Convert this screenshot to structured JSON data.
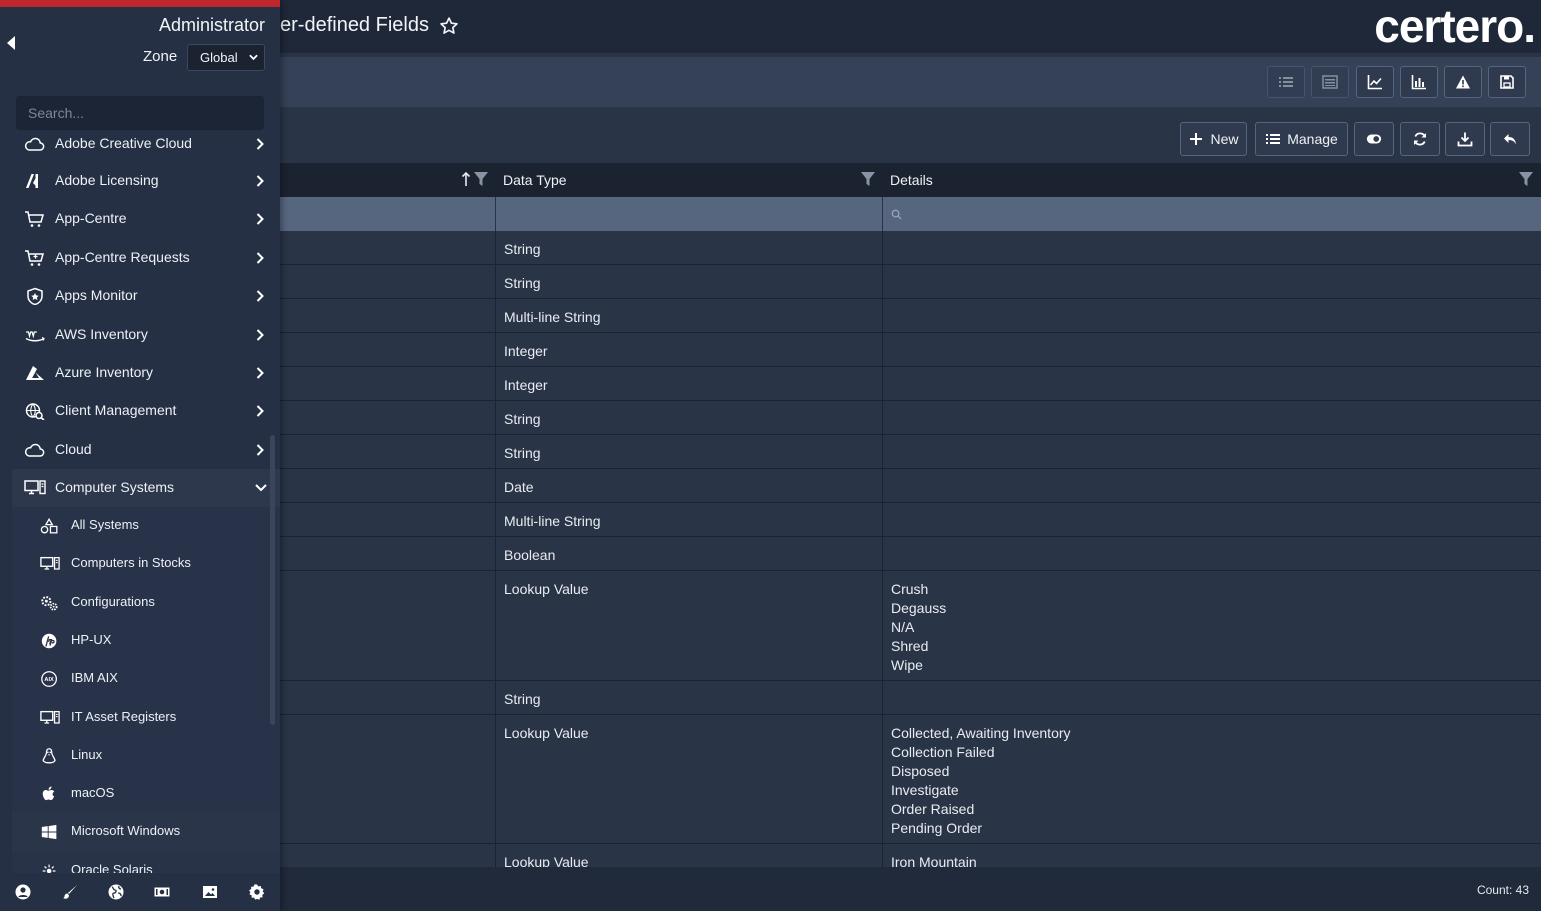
{
  "header": {
    "title": "er-defined Fields",
    "logo": "certero."
  },
  "sidebar": {
    "user": "Administrator",
    "zone_label": "Zone",
    "zone_value": "Global",
    "search_placeholder": "Search...",
    "items": [
      {
        "label": "Adobe Creative Cloud",
        "icon": "cloud-icon"
      },
      {
        "label": "Adobe Licensing",
        "icon": "adobe-icon"
      },
      {
        "label": "App-Centre",
        "icon": "cart-icon"
      },
      {
        "label": "App-Centre Requests",
        "icon": "cart-plus-icon"
      },
      {
        "label": "Apps Monitor",
        "icon": "shield-icon"
      },
      {
        "label": "AWS Inventory",
        "icon": "aws-icon"
      },
      {
        "label": "Azure Inventory",
        "icon": "azure-icon"
      },
      {
        "label": "Client Management",
        "icon": "globe-search-icon"
      },
      {
        "label": "Cloud",
        "icon": "cloud-icon"
      },
      {
        "label": "Computer Systems",
        "icon": "computer-icon"
      }
    ],
    "subitems": [
      {
        "label": "All Systems",
        "icon": "shapes-icon"
      },
      {
        "label": "Computers in Stocks",
        "icon": "computer-icon"
      },
      {
        "label": "Configurations",
        "icon": "gears-icon"
      },
      {
        "label": "HP-UX",
        "icon": "hp-icon"
      },
      {
        "label": "IBM AIX",
        "icon": "aix-icon"
      },
      {
        "label": "IT Asset Registers",
        "icon": "computer-icon"
      },
      {
        "label": "Linux",
        "icon": "linux-icon"
      },
      {
        "label": "macOS",
        "icon": "apple-icon"
      },
      {
        "label": "Microsoft Windows",
        "icon": "windows-icon"
      },
      {
        "label": "Oracle Solaris",
        "icon": "sun-icon"
      }
    ]
  },
  "actions": {
    "new_label": "New",
    "manage_label": "Manage"
  },
  "grid": {
    "columns": [
      "",
      "Data Type",
      "Details"
    ],
    "rows": [
      {
        "type": "String",
        "details": []
      },
      {
        "type": "String",
        "details": []
      },
      {
        "type": "Multi-line String",
        "details": []
      },
      {
        "type": "Integer",
        "details": []
      },
      {
        "type": "Integer",
        "details": []
      },
      {
        "type": "String",
        "details": []
      },
      {
        "type": "String",
        "details": []
      },
      {
        "type": "Date",
        "details": []
      },
      {
        "type": "Multi-line String",
        "details": []
      },
      {
        "type": "Boolean",
        "details": []
      },
      {
        "type": "Lookup Value",
        "details": [
          "Crush",
          "Degauss",
          "N/A",
          "Shred",
          "Wipe"
        ]
      },
      {
        "type": "String",
        "details": []
      },
      {
        "type": "Lookup Value",
        "details": [
          "Collected, Awaiting Inventory",
          "Collection Failed",
          "Disposed",
          "Investigate",
          "Order Raised",
          "Pending Order"
        ]
      },
      {
        "type": "Lookup Value",
        "details": [
          "Iron Mountain"
        ]
      }
    ]
  },
  "footer": {
    "count": "Count: 43"
  }
}
